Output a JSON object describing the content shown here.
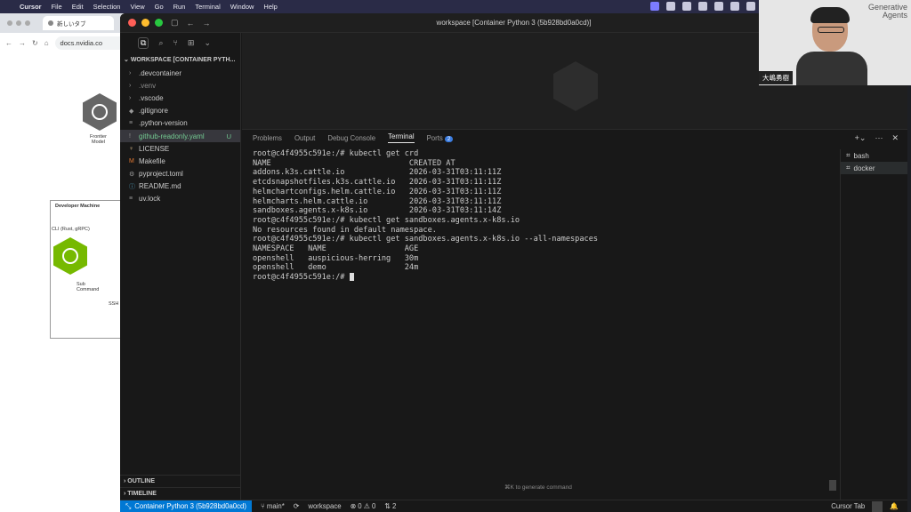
{
  "menubar": {
    "app": "Cursor",
    "items": [
      "File",
      "Edit",
      "Selection",
      "View",
      "Go",
      "Run",
      "Terminal",
      "Window",
      "Help"
    ]
  },
  "browser": {
    "tab_title": "新しいタブ",
    "url": "docs.nvidia.co",
    "diagram": {
      "frontier_label": "Frontier\nModel",
      "dev_machine": "Developer Machine",
      "cli_label": "CLI (Rust, gRPC)",
      "sub_command": "Sub\nCommand",
      "ssh": "SSH"
    }
  },
  "window": {
    "title": "workspace [Container Python 3 (5b928bd0a0cd)]"
  },
  "explorer": {
    "header": "WORKSPACE [CONTAINER PYTH...",
    "items": [
      {
        "label": ".devcontainer",
        "glyph": "›"
      },
      {
        "label": ".venv",
        "glyph": "›"
      },
      {
        "label": ".vscode",
        "glyph": "›"
      },
      {
        "label": ".gitignore",
        "glyph": "◆"
      },
      {
        "label": ".python-version",
        "glyph": "≡"
      },
      {
        "label": "github-readonly.yaml",
        "glyph": "!",
        "status": "U"
      },
      {
        "label": "LICENSE",
        "glyph": "♀"
      },
      {
        "label": "Makefile",
        "glyph": "M"
      },
      {
        "label": "pyproject.toml",
        "glyph": "⚙"
      },
      {
        "label": "README.md",
        "glyph": "ⓘ"
      },
      {
        "label": "uv.lock",
        "glyph": "≡"
      }
    ],
    "outline": "OUTLINE",
    "timeline": "TIMELINE"
  },
  "panel": {
    "tabs": [
      "Problems",
      "Output",
      "Debug Console",
      "Terminal",
      "Ports"
    ],
    "ports_count": "2",
    "terminal_lines": [
      "root@c4f4955c591e:/# kubectl get crd",
      "NAME                              CREATED AT",
      "addons.k3s.cattle.io              2026-03-31T03:11:11Z",
      "etcdsnapshotfiles.k3s.cattle.io   2026-03-31T03:11:11Z",
      "helmchartconfigs.helm.cattle.io   2026-03-31T03:11:11Z",
      "helmcharts.helm.cattle.io         2026-03-31T03:11:11Z",
      "sandboxes.agents.x-k8s.io         2026-03-31T03:11:14Z",
      "root@c4f4955c591e:/# kubectl get sandboxes.agents.x-k8s.io",
      "No resources found in default namespace.",
      "root@c4f4955c591e:/# kubectl get sandboxes.agents.x-k8s.io --all-namespaces",
      "NAMESPACE   NAME                 AGE",
      "openshell   auspicious-herring   30m",
      "openshell   demo                 24m"
    ],
    "prompt": "root@c4f4955c591e:/# ",
    "hint": "⌘K to generate command",
    "terminals": [
      "bash",
      "docker"
    ]
  },
  "statusbar": {
    "remote": "Container Python 3 (5b928bd0a0cd)",
    "branch": "main*",
    "folder": "workspace",
    "problems": "⊗ 0 ⚠ 0",
    "ports": "2",
    "cursor_tab": "Cursor Tab"
  },
  "video": {
    "brand_line1": "Generative",
    "brand_line2": "Agents",
    "name": "大嶋勇樹"
  }
}
